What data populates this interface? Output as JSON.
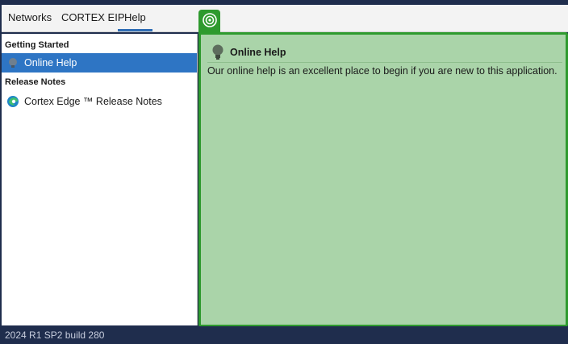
{
  "menu": {
    "tabs": [
      {
        "label": "Networks"
      },
      {
        "label": "CORTEX EIP"
      },
      {
        "label": "Help"
      }
    ]
  },
  "sidebar": {
    "sections": [
      {
        "title": "Getting Started",
        "items": [
          {
            "label": "Online Help"
          }
        ]
      },
      {
        "title": "Release Notes",
        "items": [
          {
            "label": "Cortex Edge ™ Release Notes"
          }
        ]
      }
    ]
  },
  "detail": {
    "title": "Online Help",
    "description": "Our online help is an excellent place to begin if you are new to this application."
  },
  "status": {
    "build": "2024 R1 SP2 build 280"
  },
  "colors": {
    "accent": "#2e75c4",
    "panel_green": "#aad4a9",
    "panel_border": "#2e9a2e",
    "status_bg": "#1f2d4d"
  }
}
